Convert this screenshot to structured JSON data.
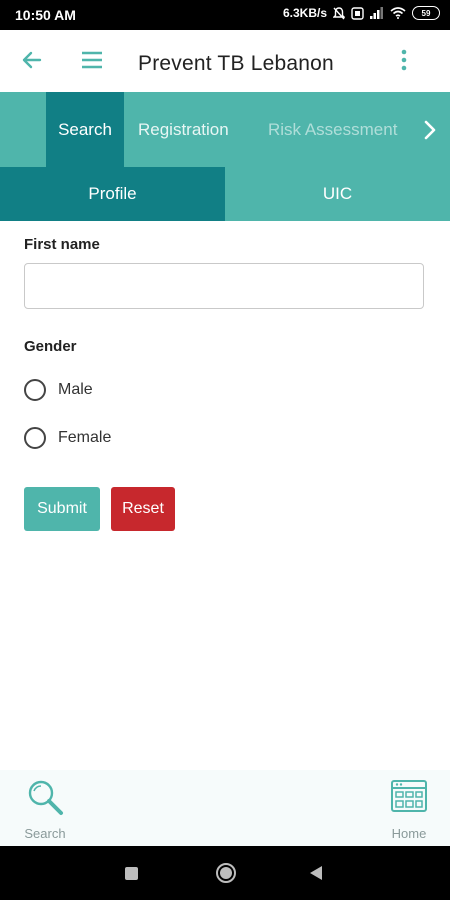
{
  "status_bar": {
    "time": "10:50 AM",
    "network_speed": "6.3KB/s",
    "battery": "59"
  },
  "app_bar": {
    "title": "Prevent TB Lebanon"
  },
  "tabs": [
    {
      "label": "Search",
      "active": true
    },
    {
      "label": "Registration",
      "active": false
    },
    {
      "label": "Risk Assessment",
      "active": false
    }
  ],
  "sub_tabs": [
    {
      "label": "Profile",
      "active": true
    },
    {
      "label": "UIC",
      "active": false
    }
  ],
  "form": {
    "first_name_label": "First name",
    "first_name_value": "",
    "gender_label": "Gender",
    "gender_options": [
      "Male",
      "Female"
    ],
    "submit_label": "Submit",
    "reset_label": "Reset"
  },
  "bottom_nav": [
    {
      "label": "Search",
      "icon": "search-icon"
    },
    {
      "label": "Home",
      "icon": "home-icon"
    }
  ],
  "colors": {
    "primary": "#4fb5ab",
    "primary_dark": "#117f85",
    "danger": "#c7282d"
  }
}
